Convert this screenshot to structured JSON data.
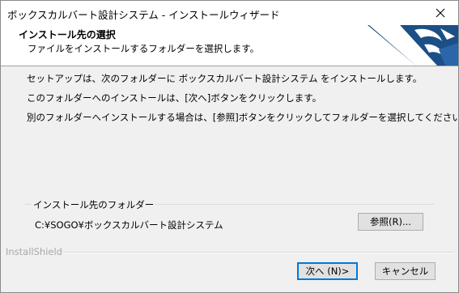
{
  "window": {
    "title": "ボックスカルバート設計システム - インストールウィザード"
  },
  "header": {
    "title": "インストール先の選択",
    "subtitle": "ファイルをインストールするフォルダーを選択します。",
    "logo_icon": "installshield-logo-icon"
  },
  "body": {
    "line1": "セットアップは、次のフォルダーに ボックスカルバート設計システム をインストールします。",
    "line2": "このフォルダーへのインストールは、[次へ]ボタンをクリックします。",
    "line3": "別のフォルダーへインストールする場合は、[参照]ボタンをクリックしてフォルダーを選択してください。"
  },
  "destination": {
    "group_label": "インストール先のフォルダー",
    "path": "C:¥SOGO¥ボックスカルバート設計システム",
    "browse_label": "参照(R)..."
  },
  "footer": {
    "brand": "InstallShield",
    "next_label": "次へ (N)>",
    "cancel_label": "キャンセル"
  },
  "colors": {
    "logo_blue": "#1c4f86",
    "default_button_border": "#0078d7"
  }
}
